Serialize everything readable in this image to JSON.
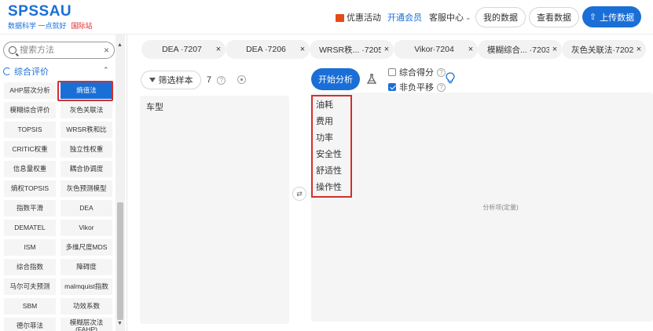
{
  "header": {
    "logo_main": "SPSSAU",
    "logo_sub": "数据科学 一点就好",
    "logo_intl": "国际站",
    "nav": {
      "promo": "优惠活动",
      "vip": "开通会员",
      "service": "客服中心",
      "service_chevron": "⌄"
    },
    "buttons": {
      "my_data": "我的数据",
      "view_data": "查看数据",
      "upload": "上传数据",
      "upload_icon": "⇧"
    }
  },
  "sidebar": {
    "search": {
      "placeholder": "搜索方法",
      "clear": "×"
    },
    "category": "综合评价",
    "category_chevron": "⌃",
    "methods": [
      "AHP层次分析",
      "熵值法",
      "模糊综合评价",
      "灰色关联法",
      "TOPSIS",
      "WRSR秩和比",
      "CRITIC权重",
      "独立性权重",
      "信息量权重",
      "耦合协调度",
      "熵权TOPSIS",
      "灰色预测模型",
      "指数平滑",
      "DEA",
      "DEMATEL",
      "Vikor",
      "ISM",
      "多维尺度MDS",
      "综合指数",
      "障碍度",
      "马尔可夫预测",
      "malmquist指数",
      "SBM",
      "功效系数",
      "德尔菲法",
      "模糊层次法(FAHP)"
    ],
    "active_method_index": 1,
    "scroll_up": "▲",
    "scroll_down": "▼"
  },
  "tabs": [
    {
      "label": "DEA ·7207",
      "close": "×"
    },
    {
      "label": "DEA ·7206",
      "close": "×"
    },
    {
      "label": "WRSR秩... ·7205",
      "close": "×"
    },
    {
      "label": "Vikor·7204",
      "close": "×"
    },
    {
      "label": "模糊综合... ·7203",
      "close": "×"
    },
    {
      "label": "灰色关联法·7202",
      "close": "×"
    }
  ],
  "variables": {
    "filter_label": "筛选样本",
    "count": "7",
    "help": "?",
    "items": [
      "车型"
    ],
    "swap": "⇄"
  },
  "analysis": {
    "start_label": "开始分析",
    "option_composite": {
      "label": "综合得分",
      "checked": false
    },
    "option_nonneg": {
      "label": "非负平移",
      "checked": true
    },
    "help": "?",
    "items": [
      "油耗",
      "费用",
      "功率",
      "安全性",
      "舒适性",
      "操作性"
    ],
    "placeholder": "分析项(定量)"
  },
  "colors": {
    "primary": "#1a6fd6",
    "highlight": "#d32f2f",
    "panel_bg": "#f5f5f5"
  }
}
